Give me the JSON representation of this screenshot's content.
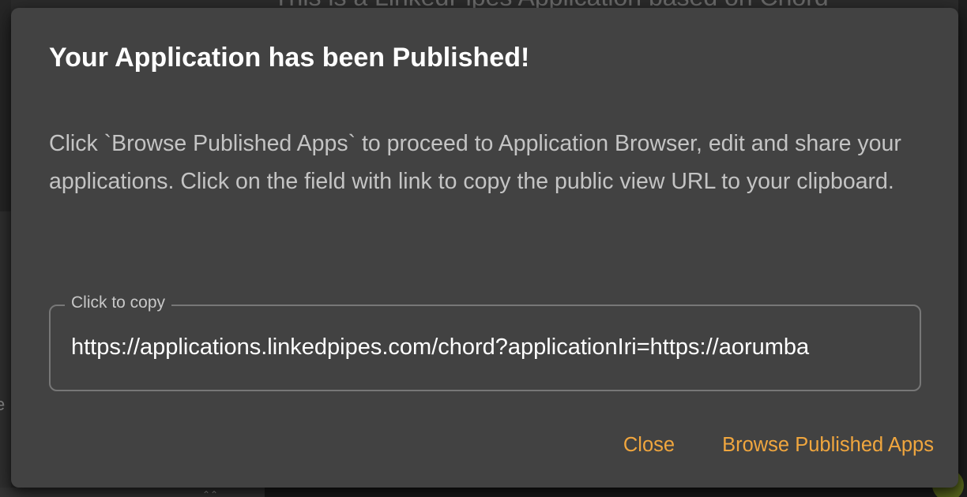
{
  "background": {
    "app_title": "This is a LinkedPipes Application based on Chord",
    "edge_letter": "e",
    "chevron": "⌃⌃"
  },
  "dialog": {
    "title": "Your Application has been Published!",
    "body": "Click `Browse Published Apps` to proceed to Application Browser, edit and share your applications. Click on the field with link to copy the public view URL to your clipboard.",
    "copy_field": {
      "label": "Click to copy",
      "value": "https://applications.linkedpipes.com/chord?applicationIri=https://aorumba"
    },
    "actions": {
      "close_label": "Close",
      "browse_label": "Browse Published Apps"
    }
  },
  "colors": {
    "dialog_bg": "#424242",
    "accent": "#f0a63e",
    "title_text": "#ffffff",
    "body_text": "#c4c4c4",
    "field_border": "#777777"
  }
}
